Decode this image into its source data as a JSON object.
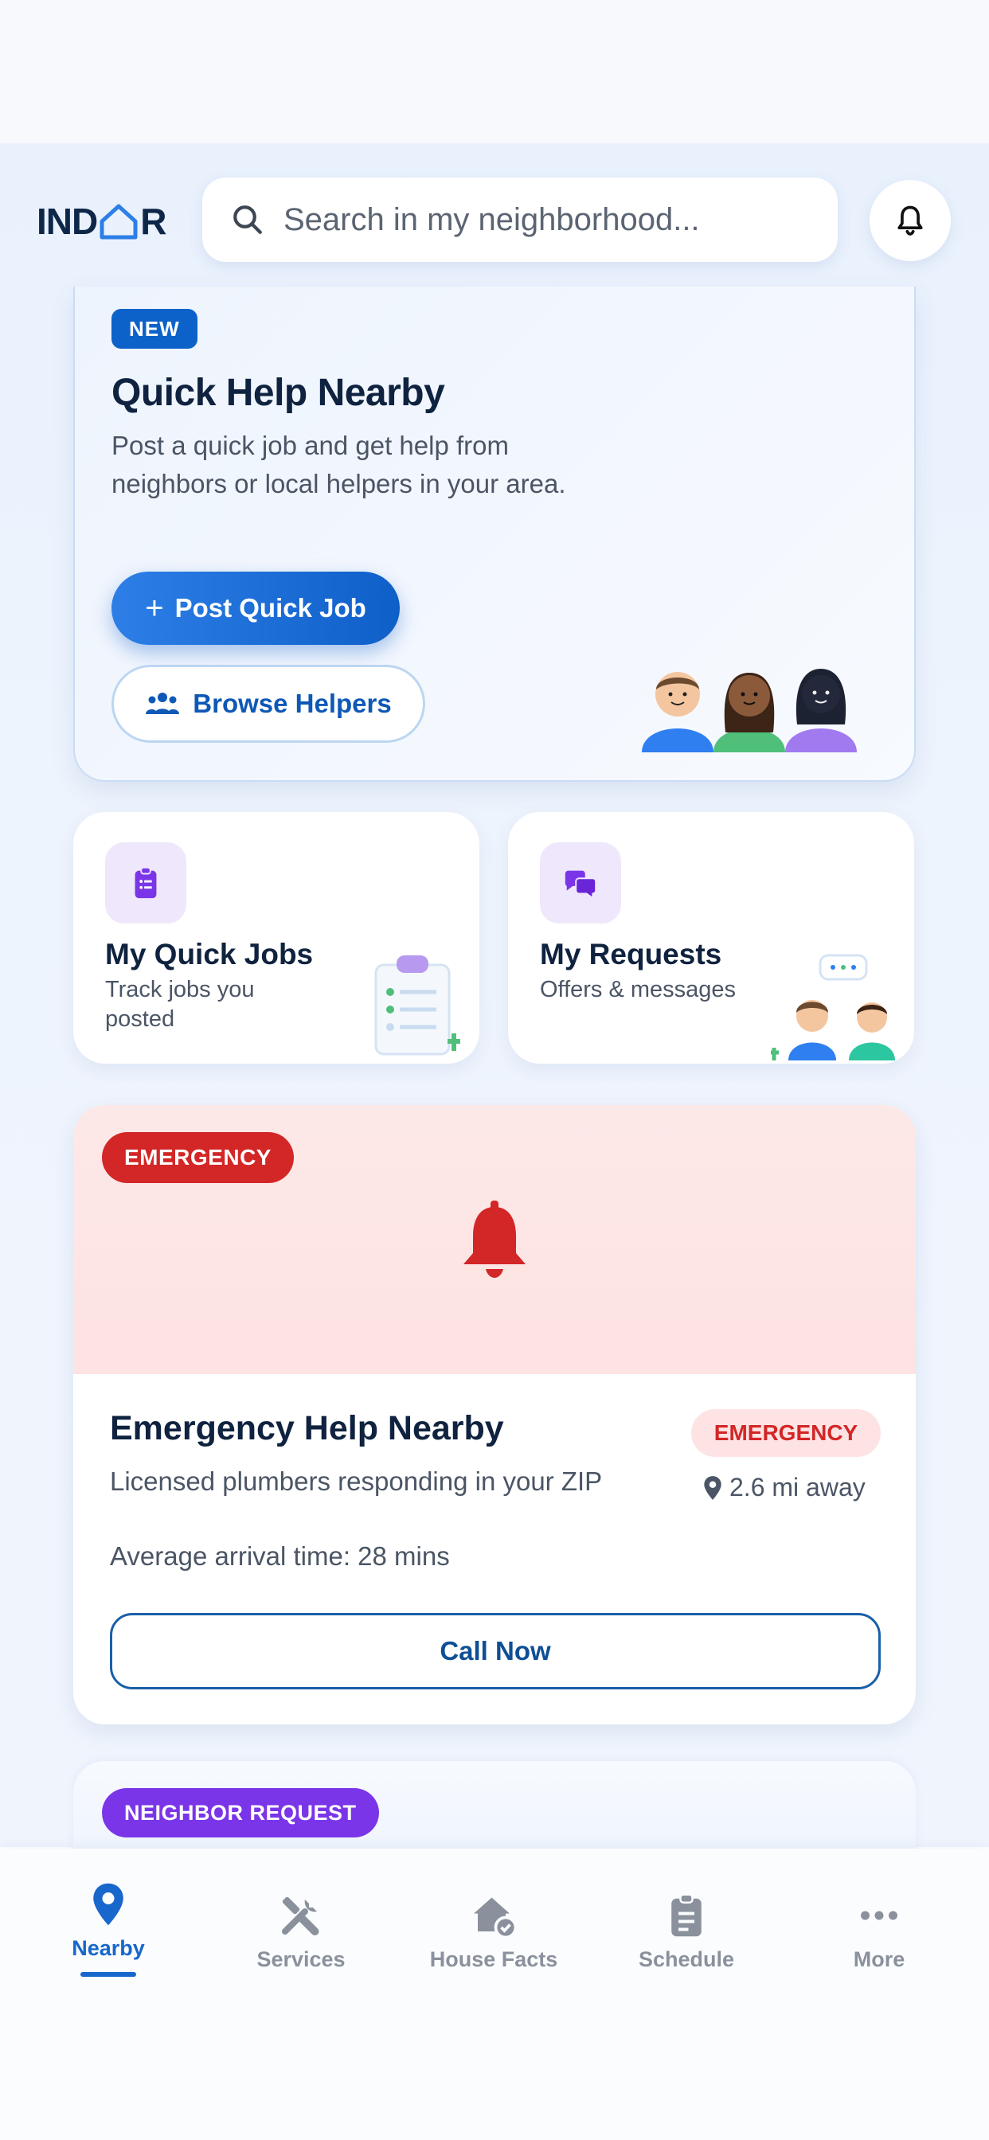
{
  "header": {
    "logo_left": "IND",
    "logo_right": "R",
    "search_placeholder": "Search in my neighborhood..."
  },
  "quick_help": {
    "badge": "NEW",
    "title": "Quick Help Nearby",
    "description": "Post a quick job and get help from neighbors or local helpers in your area.",
    "post_button": "Post Quick Job",
    "browse_button": "Browse Helpers"
  },
  "mini_cards": [
    {
      "title": "My Quick Jobs",
      "subtitle": "Track jobs you posted"
    },
    {
      "title": "My Requests",
      "subtitle": "Offers & messages"
    }
  ],
  "emergency": {
    "badge": "EMERGENCY",
    "title": "Emergency Help Nearby",
    "description": "Licensed plumbers responding in your ZIP",
    "arrival": "Average arrival time: 28 mins",
    "pill": "EMERGENCY",
    "distance": "2.6 mi away",
    "call_button": "Call Now"
  },
  "neighbor": {
    "badge": "NEIGHBOR REQUEST"
  },
  "nav": [
    {
      "label": "Nearby",
      "icon": "location-pin-icon",
      "active": true
    },
    {
      "label": "Services",
      "icon": "tools-icon",
      "active": false
    },
    {
      "label": "House Facts",
      "icon": "house-check-icon",
      "active": false
    },
    {
      "label": "Schedule",
      "icon": "clipboard-icon",
      "active": false
    },
    {
      "label": "More",
      "icon": "more-dots-icon",
      "active": false
    }
  ],
  "colors": {
    "brand_blue": "#0d62c9",
    "emergency_red": "#d32626",
    "neighbor_purple": "#7b35e8"
  }
}
